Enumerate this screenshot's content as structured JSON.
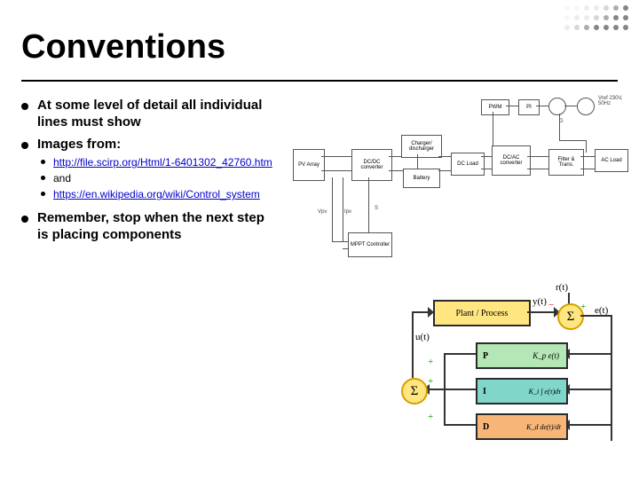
{
  "title": "Conventions",
  "bullets": {
    "b1": "At some level of detail all individual lines must show",
    "b2": "Images from:",
    "sub": {
      "link1_text": "http://file.scirp.org/Html/1-6401302_42760.htm",
      "link1_href": "http://file.scirp.org/Html/1-6401302_42760.htm",
      "and": "and",
      "link2_text": "https://en.wikipedia.org/wiki/Control_system",
      "link2_href": "https://en.wikipedia.org/wiki/Control_system"
    },
    "b3": "Remember, stop when the next step is placing components"
  },
  "schematic": {
    "pv": "PV Array",
    "dcdc": "DC/DC converter",
    "mppt": "MPPT Controller",
    "charger": "Charger/ discharger",
    "battery": "Battery",
    "dcload": "DC Load",
    "dcac": "DC/AC converter",
    "filter": "Filter & Trans.",
    "acload": "AC Load",
    "pwm": "PWM",
    "pi": "PI",
    "vref": "Vref 230V, 50Hz",
    "g": "G",
    "vpv": "Vpv",
    "ipv": "Ipv",
    "s": "S"
  },
  "pid": {
    "plant": "Plant / Process",
    "p_label": "P",
    "p_expr": "K_p e(t)",
    "i_label": "I",
    "i_expr": "K_i ∫ e(τ)dτ",
    "d_label": "D",
    "d_expr": "K_d de(t)/dt",
    "sigma": "Σ",
    "r": "r(t)",
    "y": "y(t)",
    "e": "e(t)",
    "u": "u(t)",
    "plus": "+",
    "minus": "−"
  }
}
